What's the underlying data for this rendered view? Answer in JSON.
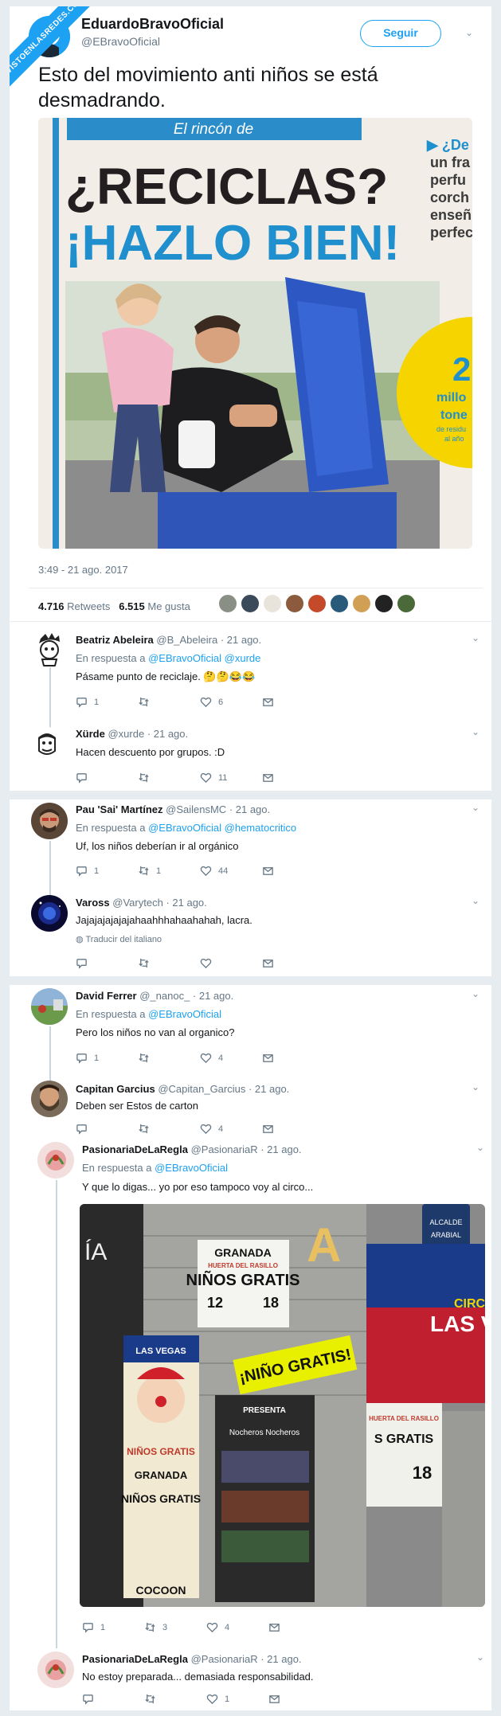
{
  "watermark": "VISTOENLASREDES.COM",
  "tweet": {
    "name": "EduardoBravoOficial",
    "handle": "@EBravoOficial",
    "follow_label": "Seguir",
    "text": "Esto del movimiento anti niños se está desmadrando.",
    "photo": {
      "tag": "El rincón de",
      "headline1": "¿RECICLAS?",
      "headline2": "¡HAZLO BIEN!",
      "side_lines": [
        "▶ ¿De",
        "un fra",
        "perfu",
        "corch",
        "enseñ",
        "perfec"
      ],
      "badge_num": "2",
      "badge_lines": [
        "millo",
        "tone",
        "de residu",
        "al año"
      ]
    },
    "timestamp": "3:49 - 21 ago. 2017",
    "retweets": "4.716",
    "retweets_label": "Retweets",
    "likes": "6.515",
    "likes_label": "Me gusta"
  },
  "replies": [
    {
      "name": "Beatriz Abeleira",
      "handle": "@B_Abeleira",
      "date": "· 21 ago.",
      "in_reply_label": "En respuesta a",
      "in_reply_to": "@EBravoOficial @xurde",
      "text": "Pásame punto de reciclaje. 🤔🤔😂😂",
      "replies": "1",
      "retweets": "",
      "likes": "6"
    },
    {
      "name": "Xürde",
      "handle": "@xurde",
      "date": "· 21 ago.",
      "text": "Hacen descuento por grupos. :D",
      "replies": "",
      "retweets": "",
      "likes": "11"
    },
    {
      "name": "Pau 'Sai' Martínez",
      "handle": "@SailensMC",
      "date": "· 21 ago.",
      "in_reply_label": "En respuesta a",
      "in_reply_to": "@EBravoOficial @hematocritico",
      "text": "Uf, los niños deberían ir al orgánico",
      "replies": "1",
      "retweets": "1",
      "likes": "44"
    },
    {
      "name": "Vaross",
      "handle": "@Varytech",
      "date": "· 21 ago.",
      "text": "Jajajajajajajahaahhhahaahahah, lacra.",
      "translate": "Traducir del italiano",
      "replies": "",
      "retweets": "",
      "likes": ""
    },
    {
      "name": "David Ferrer",
      "handle": "@_nanoc_",
      "date": "· 21 ago.",
      "in_reply_label": "En respuesta a",
      "in_reply_to": "@EBravoOficial",
      "text": "Pero los niños no van al organico?",
      "replies": "1",
      "retweets": "",
      "likes": "4"
    },
    {
      "name": "Capitan Garcius",
      "handle": "@Capitan_Garcius",
      "date": "· 21 ago.",
      "text": "Deben ser Estos de carton",
      "replies": "",
      "retweets": "",
      "likes": "4"
    },
    {
      "name": "PasionariaDeLaRegla",
      "handle": "@PasionariaR",
      "date": "· 21 ago.",
      "in_reply_label": "En respuesta a",
      "in_reply_to": "@EBravoOficial",
      "text": "Y que lo digas... yo por eso tampoco voy al circo...",
      "replies": "1",
      "retweets": "3",
      "likes": "4"
    },
    {
      "name": "PasionariaDeLaRegla",
      "handle": "@PasionariaR",
      "date": "· 21 ago.",
      "text": "No estoy preparada... demasiada responsabilidad.",
      "replies": "",
      "retweets": "",
      "likes": "1"
    }
  ],
  "circus_photo": {
    "poster1": [
      "GRANADA",
      "HUERTA DEL RASILLO",
      "NIÑOS GRATIS",
      "12",
      "18"
    ],
    "banner": "¡NIÑO GRATIS!",
    "poster2": [
      "LAS VEGAS",
      "NIÑOS GRATIS",
      "GRANADA",
      "NIÑOS GRATIS"
    ],
    "poster3": [
      "PRESENTA",
      "Nocheros Nocheros"
    ],
    "poster4": [
      "LAS V",
      "CIRC"
    ],
    "poster5": [
      "HUERTA DEL RASILLO",
      "S GRATIS",
      "18"
    ],
    "street_sign": [
      "ALCALDE",
      "ARABIAL"
    ],
    "letter_a": "A",
    "shop_letter": "ÍA",
    "cocoon": "COCOON"
  },
  "colors": {
    "accent": "#1da1f2",
    "text": "#14171a",
    "muted": "#657786",
    "border": "#e6ecf0"
  }
}
